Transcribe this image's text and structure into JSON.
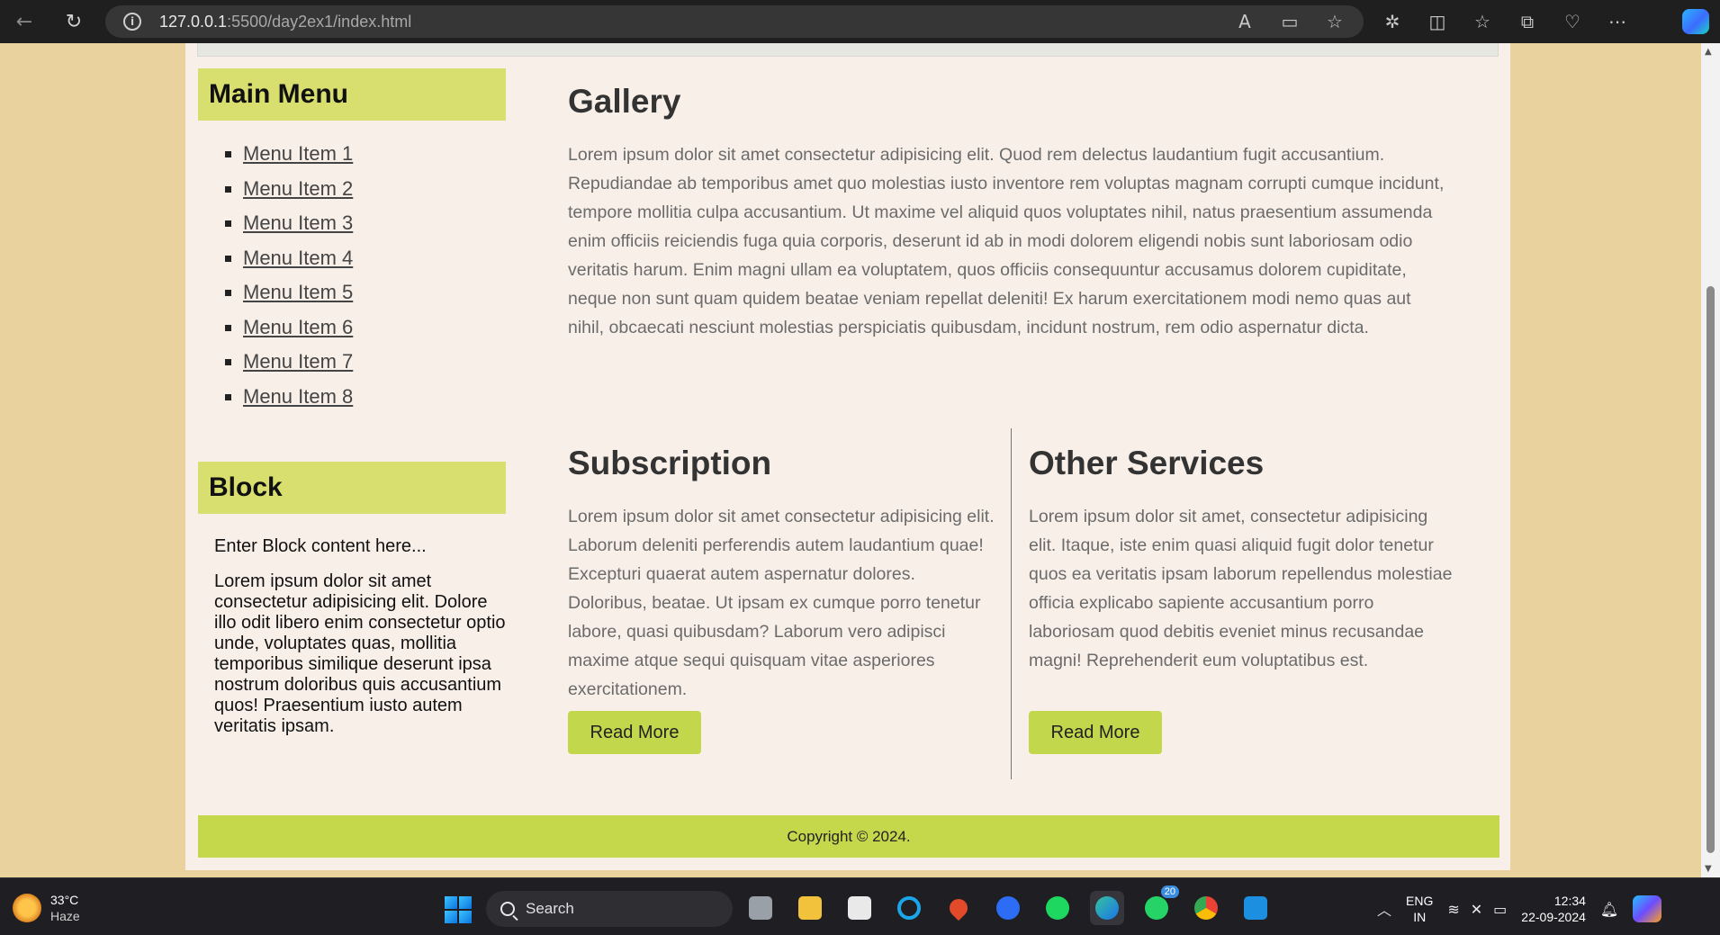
{
  "browser": {
    "url_host": "127.0.0.1",
    "url_path": ":5500/day2ex1/index.html"
  },
  "sidebar": {
    "main_menu_title": "Main Menu",
    "menu_items": [
      {
        "label": "Menu Item 1"
      },
      {
        "label": "Menu Item 2"
      },
      {
        "label": "Menu Item 3"
      },
      {
        "label": "Menu Item 4"
      },
      {
        "label": "Menu Item 5"
      },
      {
        "label": "Menu Item 6"
      },
      {
        "label": "Menu Item 7"
      },
      {
        "label": "Menu Item 8"
      }
    ],
    "block_title": "Block",
    "block_intro": "Enter Block content here...",
    "block_body": "Lorem ipsum dolor sit amet consectetur adipisicing elit. Dolore illo odit libero enim consectetur optio unde, voluptates quas, mollitia temporibus similique deserunt ipsa nostrum doloribus quis accusantium quos! Praesentium iusto autem veritatis ipsam."
  },
  "main": {
    "gallery_title": "Gallery",
    "gallery_text": "Lorem ipsum dolor sit amet consectetur adipisicing elit. Quod rem delectus laudantium fugit accusantium. Repudiandae ab temporibus amet quo molestias iusto inventore rem voluptas magnam corrupti cumque incidunt, tempore mollitia culpa accusantium. Ut maxime vel aliquid quos voluptates nihil, natus praesentium assumenda enim officiis reiciendis fuga quia corporis, deserunt id ab in modi dolorem eligendi nobis sunt laboriosam odio veritatis harum. Enim magni ullam ea voluptatem, quos officiis consequuntur accusamus dolorem cupiditate, neque non sunt quam quidem beatae veniam repellat deleniti! Ex harum exercitationem modi nemo quas aut nihil, obcaecati nesciunt molestias perspiciatis quibusdam, incidunt nostrum, rem odio aspernatur dicta.",
    "subscription": {
      "title": "Subscription",
      "text": "Lorem ipsum dolor sit amet consectetur adipisicing elit. Laborum deleniti perferendis autem laudantium quae! Excepturi quaerat autem aspernatur dolores. Doloribus, beatae. Ut ipsam ex cumque porro tenetur labore, quasi quibusdam? Laborum vero adipisci maxime atque sequi quisquam vitae asperiores exercitationem.",
      "button": "Read More"
    },
    "other_services": {
      "title": "Other Services",
      "text": "Lorem ipsum dolor sit amet, consectetur adipisicing elit. Itaque, iste enim quasi aliquid fugit dolor tenetur quos ea veritatis ipsam laborum repellendus molestiae officia explicabo sapiente accusantium porro laboriosam quod debitis eveniet minus recusandae magni! Reprehenderit eum voluptatibus est.",
      "button": "Read More"
    },
    "footer": "Copyright © 2024."
  },
  "taskbar": {
    "weather_temp": "33°C",
    "weather_condition": "Haze",
    "search_label": "Search",
    "whatsapp_badge": "20",
    "lang_line1": "ENG",
    "lang_line2": "IN",
    "time": "12:34",
    "date": "22-09-2024"
  },
  "colors": {
    "page_background": "#e9d29d",
    "container_background": "#f8f0e8",
    "sidebar_header": "#d9df6e",
    "button_accent": "#c2d74b",
    "footer": "#c5d84b"
  }
}
